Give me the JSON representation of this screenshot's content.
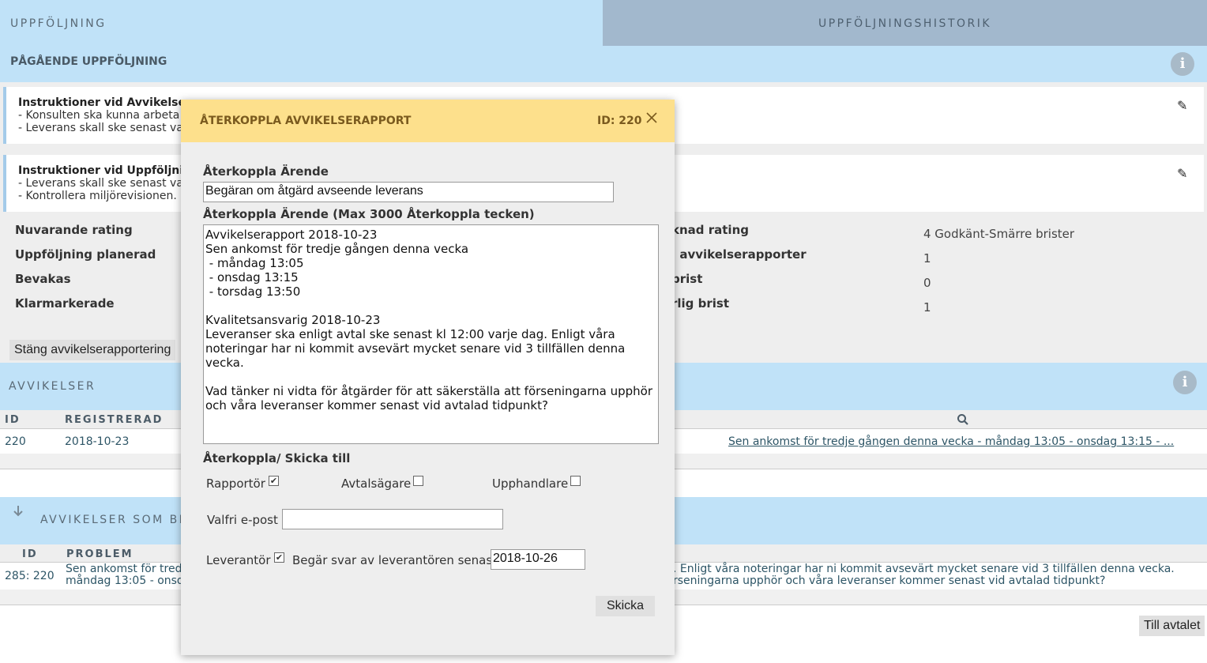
{
  "tabs": {
    "followup": "UPPFÖLJNING",
    "history": "UPPFÖLJNINGSHISTORIK"
  },
  "ongoing": {
    "title": "PÅGÅENDE UPPFÖLJNING"
  },
  "cards": [
    {
      "title": "Instruktioner vid Avvikelse",
      "line1": "- Konsulten ska kunna arbeta",
      "line2": "- Leverans skall ske senast va"
    },
    {
      "title": "Instruktioner vid Uppföljnin",
      "line1": "- Leverans skall ske senast va",
      "line2": "- Kontrollera miljörevisionen. I"
    }
  ],
  "stats_left": {
    "current_rating": "Nuvarande rating",
    "planned": "Uppföljning planerad",
    "watched": "Bevakas",
    "marked_done": "Klarmarkerade"
  },
  "stats_right": {
    "labels": [
      "knad rating",
      "l avvikelserapporter",
      "brist",
      "rlig brist"
    ],
    "values": [
      "4 Godkänt-Smärre brister",
      "1",
      "0",
      "1"
    ]
  },
  "close_reporting_button": "Stäng avvikelserapportering",
  "deviations": {
    "title": "AVVIKELSER",
    "col_id": "ID",
    "col_registered": "REGISTRERAD",
    "rows": [
      {
        "id": "220",
        "date": "2018-10-23",
        "link": "Sen ankomst för tredje gången denna vecka - måndag 13:05 - onsdag 13:15 - ..."
      }
    ]
  },
  "deviations_handled": {
    "title": "AVVIKELSER SOM BE",
    "col_id": "ID",
    "col_problem": "PROBLEM",
    "rows": [
      {
        "id": "285: 220",
        "left_line1": "Sen ankomst för tred",
        "left_line2": "måndag 13:05 - onsd",
        "right_line1": ". Enligt våra noteringar har ni kommit avsevärt mycket senare vid 3 tillfällen denna vecka.",
        "right_line2": "rseningarna upphör och våra leveranser kommer senast vid avtalad tidpunkt?"
      }
    ]
  },
  "to_agreement_button": "Till avtalet",
  "modal": {
    "title": "ÅTERKOPPLA AVVIKELSERAPPORT",
    "id_label": "ID: 220",
    "subject_label": "Återkoppla Ärende",
    "subject_value": "Begäran om åtgärd avseende leverans",
    "body_label": "Återkoppla Ärende (Max 3000 Återkoppla tecken)",
    "body_value": "Avvikelserapport 2018-10-23\nSen ankomst för tredje gången denna vecka\n - måndag 13:05\n - onsdag 13:15\n - torsdag 13:50\n\nKvalitetsansvarig 2018-10-23\nLeveranser ska enligt avtal ske senast kl 12:00 varje dag. Enligt våra noteringar har ni kommit avsevärt mycket senare vid 3 tillfällen denna vecka.\n\nVad tänker ni vidta för åtgärder för att säkerställa att förseningarna upphör och våra leveranser kommer senast vid avtalad tidpunkt?",
    "send_to_label": "Återkoppla/ Skicka till",
    "recipients": [
      {
        "label": "Rapportör",
        "checked": true
      },
      {
        "label": "Avtalsägare",
        "checked": false
      },
      {
        "label": "Upphandlare",
        "checked": false
      }
    ],
    "email_label": "Valfri e-post",
    "email_value": "",
    "supplier_label": "Leverantör",
    "supplier_checked": true,
    "reply_by_label": "Begär svar av leverantören senast",
    "reply_by_value": "2018-10-26",
    "send_button": "Skicka",
    "check_mark": "✔"
  },
  "icons": {
    "info": "info-icon",
    "pencil": "pencil-icon",
    "search": "search-icon",
    "arrow_down": "arrow-down-icon",
    "close": "close-icon"
  }
}
